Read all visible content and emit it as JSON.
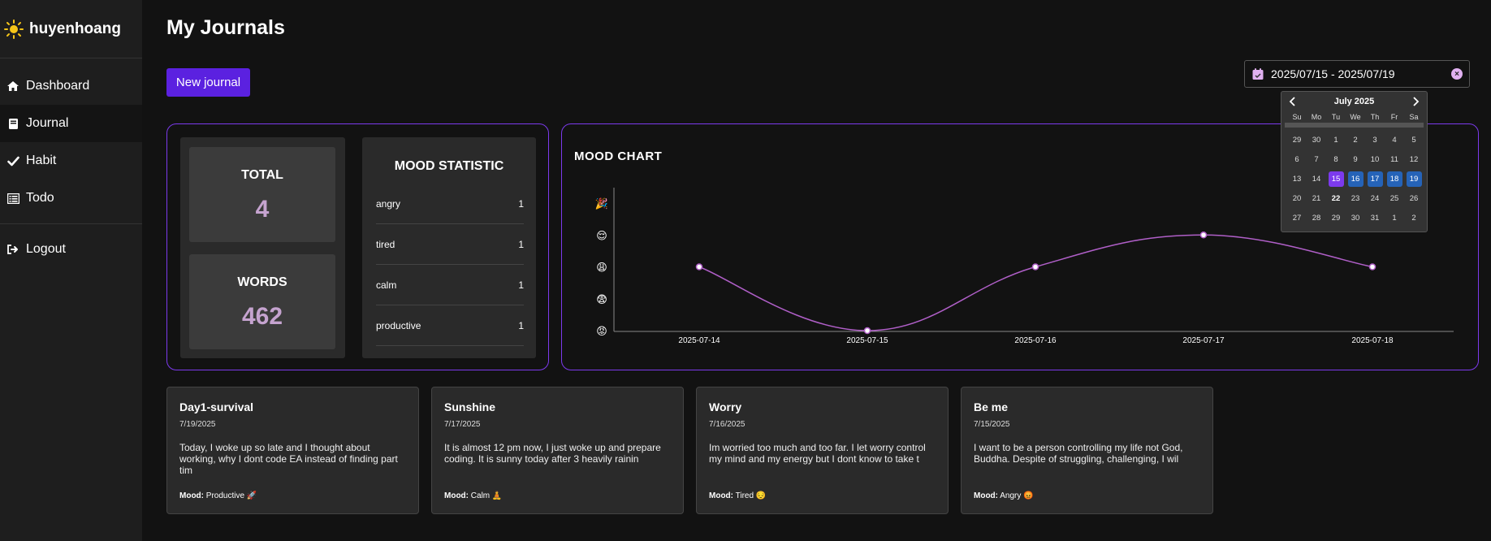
{
  "sidebar": {
    "username": "huyenhoang",
    "items": [
      {
        "label": "Dashboard",
        "icon": "home-icon",
        "active": false
      },
      {
        "label": "Journal",
        "icon": "book-icon",
        "active": true
      },
      {
        "label": "Habit",
        "icon": "checkmark-icon",
        "active": false
      },
      {
        "label": "Todo",
        "icon": "list-icon",
        "active": false
      }
    ],
    "logout_label": "Logout"
  },
  "header": {
    "title": "My Journals",
    "new_button_label": "New journal",
    "date_range_value": "2025/07/15 - 2025/07/19"
  },
  "stats": {
    "total_label": "TOTAL",
    "total_value": "4",
    "words_label": "WORDS",
    "words_value": "462"
  },
  "mood_statistic": {
    "title": "MOOD STATISTIC",
    "rows": [
      {
        "mood": "angry",
        "count": "1"
      },
      {
        "mood": "tired",
        "count": "1"
      },
      {
        "mood": "calm",
        "count": "1"
      },
      {
        "mood": "productive",
        "count": "1"
      }
    ]
  },
  "chart_data": {
    "type": "line",
    "title": "MOOD CHART",
    "x": [
      "2025-07-14",
      "2025-07-15",
      "2025-07-16",
      "2025-07-17",
      "2025-07-18"
    ],
    "y_levels": [
      "😡",
      "😨",
      "😩",
      "😌",
      "🎉"
    ],
    "values": [
      2,
      0,
      2,
      3,
      2
    ],
    "ylim": [
      0,
      4
    ],
    "line_color": "#b05fc8"
  },
  "calendar": {
    "month_label": "July 2025",
    "weekdays": [
      "Su",
      "Mo",
      "Tu",
      "We",
      "Th",
      "Fr",
      "Sa"
    ],
    "days": [
      [
        "29",
        "30",
        "1",
        "2",
        "3",
        "4",
        "5"
      ],
      [
        "6",
        "7",
        "8",
        "9",
        "10",
        "11",
        "12"
      ],
      [
        "13",
        "14",
        "15",
        "16",
        "17",
        "18",
        "19"
      ],
      [
        "20",
        "21",
        "22",
        "23",
        "24",
        "25",
        "26"
      ],
      [
        "27",
        "28",
        "29",
        "30",
        "31",
        "1",
        "2"
      ]
    ],
    "range_start": "15",
    "range_days": [
      "16",
      "17",
      "18",
      "19"
    ],
    "today": "22"
  },
  "journals": [
    {
      "title": "Day1-survival",
      "date": "7/19/2025",
      "body": "Today, I woke up so late and I thought about working, why I dont code EA instead of finding part tim",
      "mood_label": "Mood:",
      "mood": "Productive 🚀"
    },
    {
      "title": "Sunshine",
      "date": "7/17/2025",
      "body": "It is almost 12 pm now, I just woke up and prepare coding. It is sunny today after 3 heavily rainin",
      "mood_label": "Mood:",
      "mood": "Calm 🧘"
    },
    {
      "title": "Worry",
      "date": "7/16/2025",
      "body": "Im worried too much and too far. I let worry control my mind and my energy but I dont know to take t",
      "mood_label": "Mood:",
      "mood": "Tired 😔"
    },
    {
      "title": "Be me",
      "date": "7/15/2025",
      "body": "I want to be a person controlling my life not God, Buddha. Despite of struggling, challenging, I wil",
      "mood_label": "Mood:",
      "mood": "Angry 😡"
    }
  ],
  "colors": {
    "accent": "#7c3aed",
    "button": "#5b21e0",
    "range": "#2563b8",
    "stat_value": "#c5a3cf"
  }
}
